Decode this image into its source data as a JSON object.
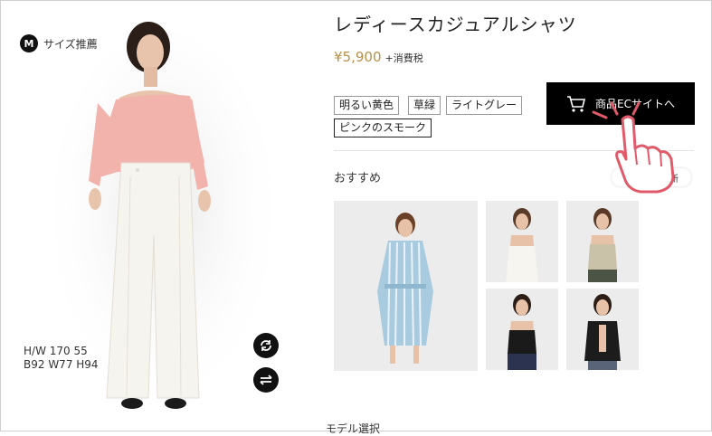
{
  "product": {
    "title": "レディースカジュアルシャツ",
    "price": "¥5,900",
    "tax_note": "+消費税",
    "colors": [
      "明るい黄色",
      "草緑",
      "ライトグレー",
      "ピンクのスモーク"
    ],
    "selected_color_index": 3,
    "cart_button_label": "商品ECサイトへ"
  },
  "fitting": {
    "size_badge": "M",
    "size_recommend_label": "サイズ推薦",
    "hw_line": "H/W  170  55",
    "body_line": "B92  W77  H94"
  },
  "recommend": {
    "label": "おすすめ",
    "refresh_label": "更新",
    "items": [
      "blue-striped-shirt-dress",
      "white-camisole",
      "khaki-lace-camisole",
      "black-strap-camisole",
      "black-cardigan"
    ]
  },
  "footer": {
    "model_select_label": "モデル選択"
  },
  "colors": {
    "price": "#b8914a",
    "button_bg": "#000000",
    "pointer": "#e05a6a"
  }
}
